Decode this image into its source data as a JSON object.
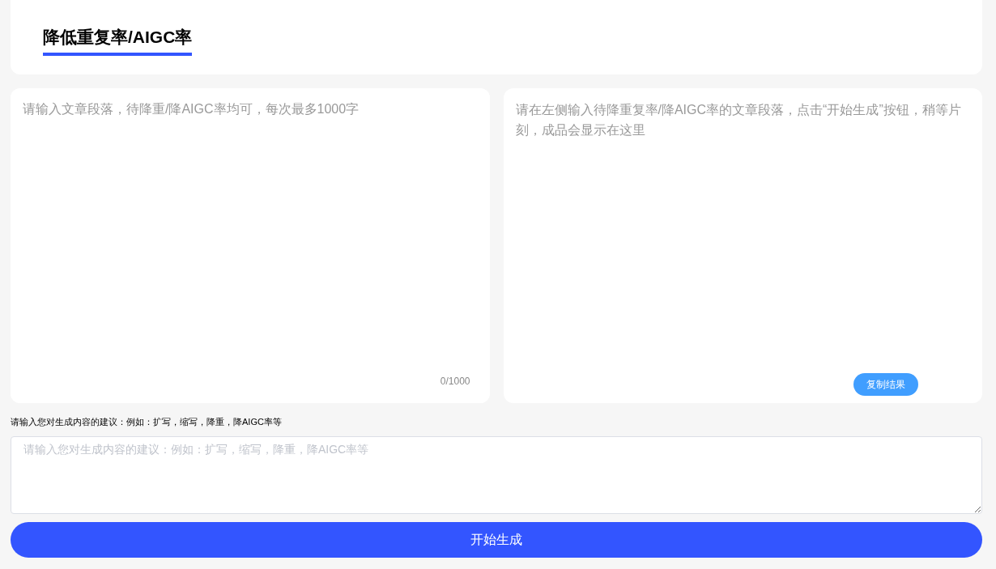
{
  "tabs": [
    {
      "label": "降低重复率/AIGC率",
      "selected": true
    }
  ],
  "source": {
    "placeholder": "请输入文章段落，待降重/降AIGC率均可，每次最多1000字",
    "counter": "0/1000"
  },
  "result": {
    "hint": "请在左侧输入待降重复率/降AIGC率的文章段落，点击“开始生成”按钮，稍等片刻，成品会显示在这里",
    "copy_button": "复制结果"
  },
  "suggestion": {
    "label": "请输入您对生成内容的建议：例如：扩写，缩写，降重，降AIGC率等",
    "placeholder": "请输入您对生成内容的建议：例如：扩写，缩写，降重，降AIGC率等"
  },
  "submit_button": "开始生成"
}
